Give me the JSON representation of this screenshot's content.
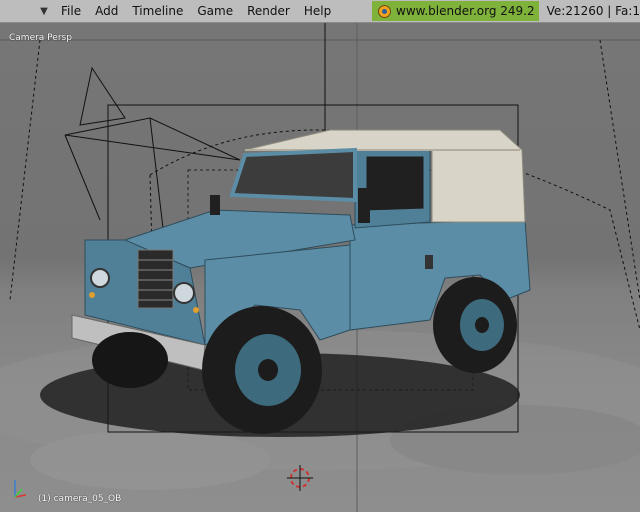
{
  "menubar": {
    "collapse_arrow": "▼",
    "menus": [
      "File",
      "Add",
      "Timeline",
      "Game",
      "Render",
      "Help"
    ],
    "site": "www.blender.org 249.2",
    "stats": "Ve:21260 | Fa:1"
  },
  "viewport": {
    "label": "Camera Persp",
    "object_label": "(1) camera_05_OB"
  },
  "colors": {
    "menubar_bg": "#bdbdbd",
    "badge_green": "#7fb23b",
    "car_body": "#5b8ea6",
    "car_roof": "#d8d4c8"
  },
  "icons": [
    "blender-logo-icon",
    "axis-gizmo-icon",
    "3d-cursor-icon"
  ]
}
